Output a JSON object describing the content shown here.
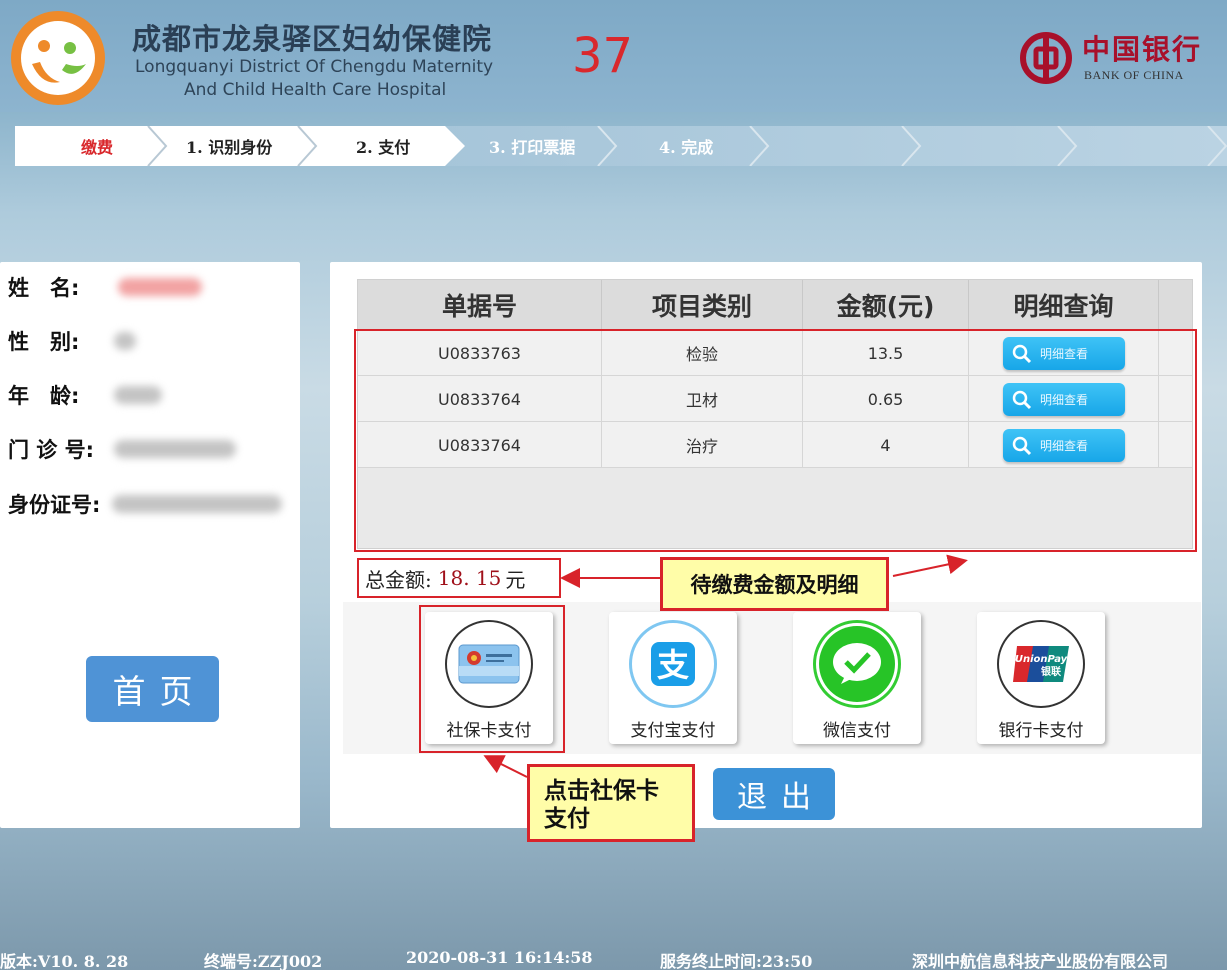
{
  "header": {
    "hospital_name_cn": "成都市龙泉驿区妇幼保健院",
    "hospital_name_en_line1": "Longquanyi District Of Chengdu Maternity",
    "hospital_name_en_line2": "And Child Health Care Hospital",
    "counter": "37",
    "bank_name_cn": "中国银行",
    "bank_name_en": "BANK OF CHINA"
  },
  "steps": [
    {
      "label": "缴费",
      "color": "#d9282c"
    },
    {
      "label": "1. 识别身份",
      "color": "#222222"
    },
    {
      "label": "2. 支付",
      "color": "#222222"
    },
    {
      "label": "3. 打印票据",
      "color": "#ffffff"
    },
    {
      "label": "4. 完成",
      "color": "#ffffff"
    }
  ],
  "patient": {
    "labels": {
      "name": "姓　名:",
      "gender": "性　别:",
      "age": "年　龄:",
      "outpatient_no": "门 诊 号:",
      "id_no": "身份证号:"
    }
  },
  "home_button": "首页",
  "table": {
    "headers": [
      "单据号",
      "项目类别",
      "金额(元)",
      "明细查询"
    ],
    "rows": [
      {
        "bill_no": "U0833763",
        "category": "检验",
        "amount": "13.5",
        "detail": "明细查看"
      },
      {
        "bill_no": "U0833764",
        "category": "卫材",
        "amount": "0.65",
        "detail": "明细查看"
      },
      {
        "bill_no": "U0833764",
        "category": "治疗",
        "amount": "4",
        "detail": "明细查看"
      }
    ]
  },
  "total": {
    "label": "总金额:",
    "amount": "18. 15",
    "unit": "元"
  },
  "payment_methods": [
    {
      "label": "社保卡支付",
      "icon": "social-security-card-icon"
    },
    {
      "label": "支付宝支付",
      "icon": "alipay-icon",
      "color": "#1a9ee8"
    },
    {
      "label": "微信支付",
      "icon": "wechat-pay-icon",
      "color": "#27c427"
    },
    {
      "label": "银行卡支付",
      "icon": "unionpay-icon"
    }
  ],
  "exit_button": "退出",
  "annotations": {
    "amount_callout": "待缴费金额及明细",
    "click_callout_line1": "点击社保卡",
    "click_callout_line2": "支付"
  },
  "footer": {
    "version": "版本:V10. 8. 28",
    "terminal": "终端号:ZZJ002",
    "datetime": "2020-08-31  16:14:58",
    "service_end": "服务终止时间:23:50",
    "company": "深圳中航信息科技产业股份有限公司"
  },
  "colors": {
    "accent_red": "#d8232a",
    "button_blue": "#3c92d7",
    "callout_yellow": "#fffda8"
  }
}
